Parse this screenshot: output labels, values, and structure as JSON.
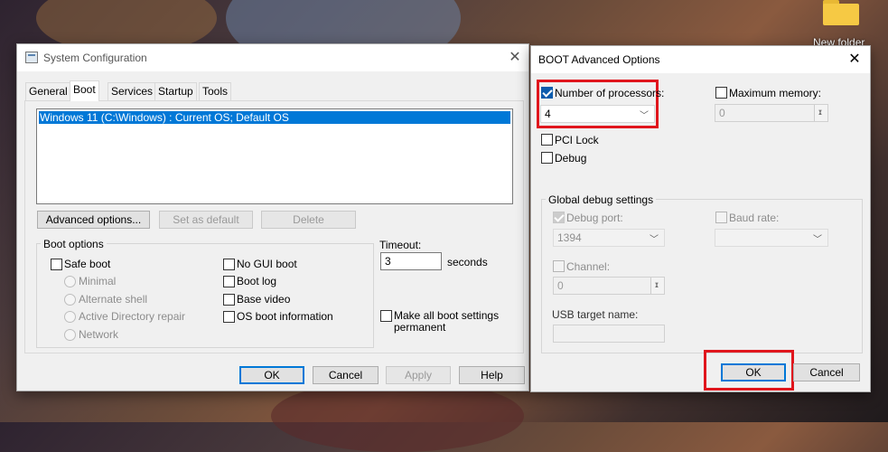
{
  "desktop": {
    "folder_label": "New folder",
    "folder_color": "#f6c944"
  },
  "sysconfig": {
    "title": "System Configuration",
    "tabs": [
      "General",
      "Boot",
      "Services",
      "Startup",
      "Tools"
    ],
    "active_tab": "Boot",
    "os_list": [
      "Windows 11 (C:\\Windows) : Current OS; Default OS"
    ],
    "buttons": {
      "advanced": "Advanced options...",
      "set_default": "Set as default",
      "delete": "Delete",
      "ok": "OK",
      "cancel": "Cancel",
      "apply": "Apply",
      "help": "Help"
    },
    "boot_options": {
      "group_label": "Boot options",
      "safe_boot": "Safe boot",
      "minimal": "Minimal",
      "alternate_shell": "Alternate shell",
      "ad_repair": "Active Directory repair",
      "network": "Network",
      "no_gui": "No GUI boot",
      "boot_log": "Boot log",
      "base_video": "Base video",
      "os_boot_info": "OS boot information"
    },
    "timeout": {
      "label": "Timeout:",
      "value": "3",
      "unit": "seconds"
    },
    "permanent": {
      "line1": "Make all boot settings",
      "line2": "permanent"
    }
  },
  "advanced": {
    "title": "BOOT Advanced Options",
    "num_processors": {
      "label": "Number of processors:",
      "checked": true,
      "value": "4"
    },
    "max_memory": {
      "label": "Maximum memory:",
      "checked": false,
      "value": "0"
    },
    "pci_lock": "PCI Lock",
    "debug": "Debug",
    "global_debug": {
      "group_label": "Global debug settings",
      "debug_port": {
        "label": "Debug port:",
        "value": "1394"
      },
      "baud_rate": {
        "label": "Baud rate:",
        "value": ""
      },
      "channel": {
        "label": "Channel:",
        "value": "0"
      },
      "usb_target": {
        "label": "USB target name:",
        "value": ""
      }
    },
    "buttons": {
      "ok": "OK",
      "cancel": "Cancel"
    }
  },
  "colors": {
    "highlight": "#e0161d",
    "selection": "#0078d7",
    "checkbox_accent": "#0b5cad"
  }
}
